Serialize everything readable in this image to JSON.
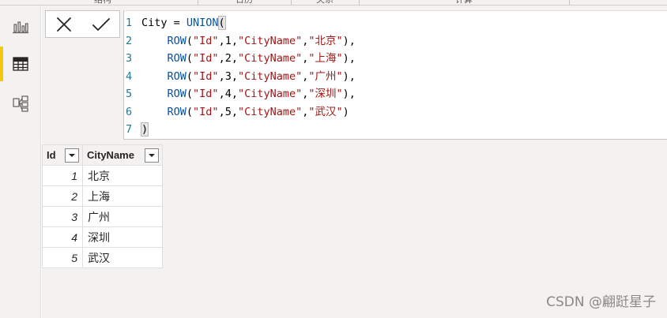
{
  "ribbon": {
    "groups": [
      "结构",
      "日历",
      "关系",
      "计算"
    ]
  },
  "rail": {
    "items": [
      {
        "icon": "report-view-icon",
        "active": false
      },
      {
        "icon": "data-view-icon",
        "active": true
      },
      {
        "icon": "model-view-icon",
        "active": false
      }
    ]
  },
  "confirm": {
    "cancel_icon": "close-icon",
    "commit_icon": "check-icon"
  },
  "editor": {
    "lines": [
      {
        "n": "1",
        "parts": [
          {
            "t": "City = ",
            "c": ""
          },
          {
            "t": "UNION",
            "c": "kw"
          },
          {
            "t": "(",
            "c": "paren"
          }
        ]
      },
      {
        "n": "2",
        "parts": [
          {
            "t": "    ",
            "c": ""
          },
          {
            "t": "ROW",
            "c": "kw"
          },
          {
            "t": "(",
            "c": ""
          },
          {
            "t": "\"Id\"",
            "c": "str"
          },
          {
            "t": ",1,",
            "c": ""
          },
          {
            "t": "\"CityName\"",
            "c": "str"
          },
          {
            "t": ",",
            "c": ""
          },
          {
            "t": "\"北京\"",
            "c": "str"
          },
          {
            "t": "),",
            "c": ""
          }
        ]
      },
      {
        "n": "3",
        "parts": [
          {
            "t": "    ",
            "c": ""
          },
          {
            "t": "ROW",
            "c": "kw"
          },
          {
            "t": "(",
            "c": ""
          },
          {
            "t": "\"Id\"",
            "c": "str"
          },
          {
            "t": ",2,",
            "c": ""
          },
          {
            "t": "\"CityName\"",
            "c": "str"
          },
          {
            "t": ",",
            "c": ""
          },
          {
            "t": "\"上海\"",
            "c": "str"
          },
          {
            "t": "),",
            "c": ""
          }
        ]
      },
      {
        "n": "4",
        "parts": [
          {
            "t": "    ",
            "c": ""
          },
          {
            "t": "ROW",
            "c": "kw"
          },
          {
            "t": "(",
            "c": ""
          },
          {
            "t": "\"Id\"",
            "c": "str"
          },
          {
            "t": ",3,",
            "c": ""
          },
          {
            "t": "\"CityName\"",
            "c": "str"
          },
          {
            "t": ",",
            "c": ""
          },
          {
            "t": "\"广州\"",
            "c": "str"
          },
          {
            "t": "),",
            "c": ""
          }
        ]
      },
      {
        "n": "5",
        "parts": [
          {
            "t": "    ",
            "c": ""
          },
          {
            "t": "ROW",
            "c": "kw"
          },
          {
            "t": "(",
            "c": ""
          },
          {
            "t": "\"Id\"",
            "c": "str"
          },
          {
            "t": ",4,",
            "c": ""
          },
          {
            "t": "\"CityName\"",
            "c": "str"
          },
          {
            "t": ",",
            "c": ""
          },
          {
            "t": "\"深圳\"",
            "c": "str"
          },
          {
            "t": "),",
            "c": ""
          }
        ]
      },
      {
        "n": "6",
        "parts": [
          {
            "t": "    ",
            "c": ""
          },
          {
            "t": "ROW",
            "c": "kw"
          },
          {
            "t": "(",
            "c": ""
          },
          {
            "t": "\"Id\"",
            "c": "str"
          },
          {
            "t": ",5,",
            "c": ""
          },
          {
            "t": "\"CityName\"",
            "c": "str"
          },
          {
            "t": ",",
            "c": ""
          },
          {
            "t": "\"武汉\"",
            "c": "str"
          },
          {
            "t": ")",
            "c": ""
          }
        ]
      },
      {
        "n": "7",
        "parts": [
          {
            "t": ")",
            "c": "paren"
          }
        ]
      }
    ]
  },
  "table": {
    "columns": [
      "Id",
      "CityName"
    ],
    "rows": [
      [
        "1",
        "北京"
      ],
      [
        "2",
        "上海"
      ],
      [
        "3",
        "广州"
      ],
      [
        "4",
        "深圳"
      ],
      [
        "5",
        "武汉"
      ]
    ]
  },
  "watermark": "CSDN @翩跹星子",
  "colors": {
    "accent": "#f2c811",
    "keyword": "#0451a5",
    "string": "#a31515",
    "line_number": "#237893"
  }
}
